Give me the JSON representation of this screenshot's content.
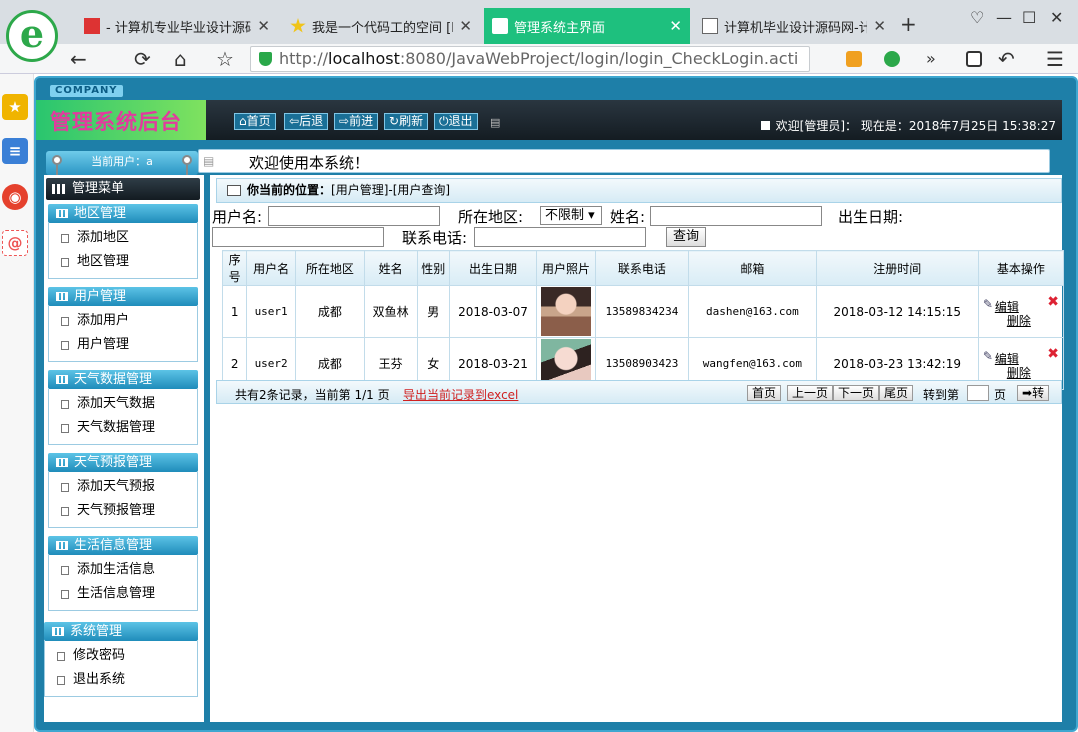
{
  "browser": {
    "logo_letter": "e",
    "tabs": [
      {
        "label": "- 计算机专业毕业设计源码网",
        "active": false
      },
      {
        "label": "我是一个代码工的空间 [htt",
        "active": false
      },
      {
        "label": "管理系统主界面",
        "active": true
      },
      {
        "label": "计算机毕业设计源码网-计算",
        "active": false
      }
    ],
    "new_tab": "+",
    "url_scheme": "http://",
    "url_host": "localhost",
    "url_rest": ":8080/JavaWebProject/login/login_CheckLogin.acti",
    "icons": {
      "back": "←",
      "refresh": "⟳",
      "home": "⌂",
      "star": "☆",
      "menu": "☰",
      "undo": "↶",
      "more": "»",
      "minimize": "—",
      "maximize": "☐",
      "close": "✕",
      "shirt": "♡"
    }
  },
  "app": {
    "company": "COMPANY",
    "title": "管理系统后台",
    "toolbar": {
      "home": "首页",
      "back": "后退",
      "forward": "前进",
      "refresh": "刷新",
      "logout": "退出"
    },
    "welcome_prefix": "欢迎[管理员]",
    "welcome_time": "现在是：2018年7月25日 15:38:27",
    "current_user": "当前用户：a",
    "notice": "欢迎使用本系统！"
  },
  "menu": {
    "header": "管理菜单",
    "groups": [
      {
        "title": "地区管理",
        "items": [
          "添加地区",
          "地区管理"
        ]
      },
      {
        "title": "用户管理",
        "items": [
          "添加用户",
          "用户管理"
        ]
      },
      {
        "title": "天气数据管理",
        "items": [
          "添加天气数据",
          "天气数据管理"
        ]
      },
      {
        "title": "天气预报管理",
        "items": [
          "添加天气预报",
          "天气预报管理"
        ]
      },
      {
        "title": "生活信息管理",
        "items": [
          "添加生活信息",
          "生活信息管理"
        ]
      },
      {
        "title": "系统管理",
        "items": [
          "修改密码",
          "退出系统"
        ]
      }
    ]
  },
  "main": {
    "crumb_label": "你当前的位置：",
    "crumb_path": "[用户管理]-[用户查询]",
    "search": {
      "username_label": "用户名:",
      "area_label": "所在地区:",
      "area_value": "不限制",
      "name_label": "姓名:",
      "birthday_label": "出生日期:",
      "phone_label": "联系电话:",
      "button": "查询"
    },
    "columns": [
      "序号",
      "用户名",
      "所在地区",
      "姓名",
      "性别",
      "出生日期",
      "用户照片",
      "联系电话",
      "邮箱",
      "注册时间",
      "基本操作"
    ],
    "rows": [
      {
        "no": "1",
        "username": "user1",
        "area": "成都",
        "name": "双鱼林",
        "sex": "男",
        "birthday": "2018-03-07",
        "phone": "13589834234",
        "email": "dashen@163.com",
        "regtime": "2018-03-12 14:15:15"
      },
      {
        "no": "2",
        "username": "user2",
        "area": "成都",
        "name": "王芬",
        "sex": "女",
        "birthday": "2018-03-21",
        "phone": "13508903423",
        "email": "wangfen@163.com",
        "regtime": "2018-03-23 13:42:19"
      }
    ],
    "ops": {
      "edit": "编辑",
      "delete": "删除"
    },
    "pager": {
      "info": "共有2条记录，当前第 1/1 页",
      "export": "导出当前记录到excel",
      "first": "首页",
      "prev": "上一页",
      "next": "下一页",
      "last": "尾页",
      "goto": "转到第",
      "page": "页",
      "go": "转"
    }
  }
}
